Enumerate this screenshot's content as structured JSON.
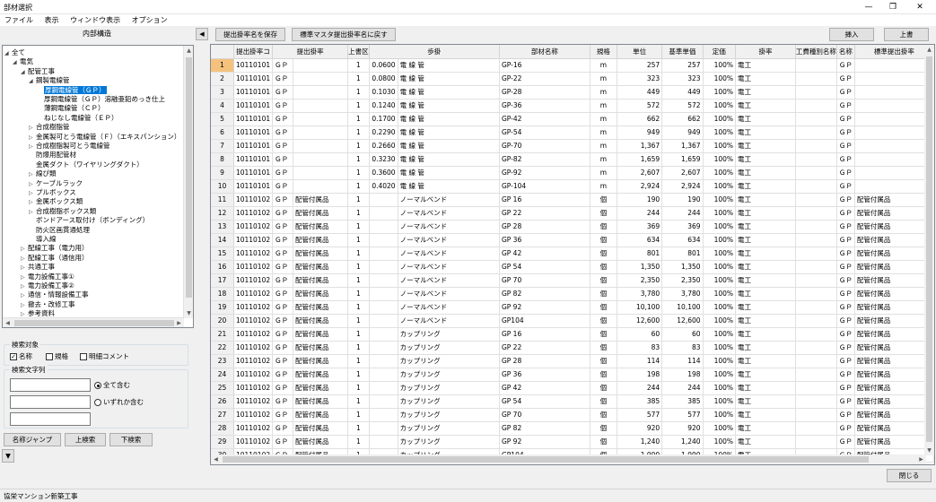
{
  "window": {
    "title": "部材選択",
    "minimize": "—",
    "restore": "❐",
    "close": "✕"
  },
  "menu": [
    "ファイル",
    "表示",
    "ウィンドウ表示",
    "オプション"
  ],
  "left_panel": {
    "title": "内部構造",
    "collapse_icon": "◀"
  },
  "tree": [
    {
      "label": "全て",
      "level": 0,
      "tw": "◢"
    },
    {
      "label": "電気",
      "level": 1,
      "tw": "◢"
    },
    {
      "label": "配管工事",
      "level": 2,
      "tw": "◢"
    },
    {
      "label": "鋼製電線管",
      "level": 3,
      "tw": "◢"
    },
    {
      "label": "厚鋼電線管（ＧＰ）",
      "level": 4,
      "tw": "",
      "selected": true
    },
    {
      "label": "厚鋼電線管（ＧＰ）溶融亜鉛めっき仕上",
      "level": 4,
      "tw": ""
    },
    {
      "label": "薄鋼電線管（ＣＰ）",
      "level": 4,
      "tw": ""
    },
    {
      "label": "ねじなし電線管（ＥＰ）",
      "level": 4,
      "tw": ""
    },
    {
      "label": "合成樹脂管",
      "level": 3,
      "tw": "▷"
    },
    {
      "label": "金属製可とう電線管（Ｆ）（エキスパンション）",
      "level": 3,
      "tw": "▷"
    },
    {
      "label": "合成樹脂製可とう電線管",
      "level": 3,
      "tw": "▷"
    },
    {
      "label": "防爆用配管材",
      "level": 3,
      "tw": ""
    },
    {
      "label": "金属ダクト（ワイヤリングダクト）",
      "level": 3,
      "tw": ""
    },
    {
      "label": "線ぴ類",
      "level": 3,
      "tw": "▷"
    },
    {
      "label": "ケーブルラック",
      "level": 3,
      "tw": "▷"
    },
    {
      "label": "プルボックス",
      "level": 3,
      "tw": "▷"
    },
    {
      "label": "金属ボックス類",
      "level": 3,
      "tw": "▷"
    },
    {
      "label": "合成樹脂ボックス類",
      "level": 3,
      "tw": "▷"
    },
    {
      "label": "ボンドアース取付け（ボンディング）",
      "level": 3,
      "tw": ""
    },
    {
      "label": "防火区画貫通処理",
      "level": 3,
      "tw": ""
    },
    {
      "label": "導入線",
      "level": 3,
      "tw": ""
    },
    {
      "label": "配線工事（電力用）",
      "level": 2,
      "tw": "▷"
    },
    {
      "label": "配線工事（通信用）",
      "level": 2,
      "tw": "▷"
    },
    {
      "label": "共通工事",
      "level": 2,
      "tw": "▷"
    },
    {
      "label": "電力設備工事①",
      "level": 2,
      "tw": "▷"
    },
    {
      "label": "電力設備工事②",
      "level": 2,
      "tw": "▷"
    },
    {
      "label": "通信・情報設備工事",
      "level": 2,
      "tw": "▷"
    },
    {
      "label": "撤去・改修工事",
      "level": 2,
      "tw": "▷"
    },
    {
      "label": "参考資料",
      "level": 2,
      "tw": "▷"
    }
  ],
  "search_target": {
    "title": "検索対象",
    "name": "名称",
    "spec": "規格",
    "comment": "明細コメント",
    "name_checked": "✓"
  },
  "search_text": {
    "title": "検索文字列",
    "all": "全て含む",
    "any": "いずれか含む"
  },
  "buttons": {
    "name_jump": "名称ジャンプ",
    "up_search": "上検索",
    "down_search": "下検索",
    "expand": "▼",
    "save_rate": "提出掛率名を保存",
    "reset_rate": "標準マスタ提出掛率名に戻す",
    "insert": "挿入",
    "overwrite": "上書",
    "close": "閉じる"
  },
  "grid": {
    "headers": [
      "",
      "提出掛率コ",
      "提出掛率",
      "上書区",
      "歩掛",
      "部材名称",
      "規格",
      "単位",
      "基準単価",
      "定価",
      "掛率",
      "工費種別名称",
      "名称",
      "標準提出掛率"
    ],
    "rows": [
      [
        "1",
        "10110101",
        "ＧＰ",
        "",
        "1",
        "0.0600",
        "電 線 管",
        "GP-16",
        "m",
        "257",
        "257",
        "100%",
        "電工",
        "",
        "ＧＰ",
        ""
      ],
      [
        "2",
        "10110101",
        "ＧＰ",
        "",
        "1",
        "0.0800",
        "電 線 管",
        "GP-22",
        "m",
        "323",
        "323",
        "100%",
        "電工",
        "",
        "ＧＰ",
        ""
      ],
      [
        "3",
        "10110101",
        "ＧＰ",
        "",
        "1",
        "0.1030",
        "電 線 管",
        "GP-28",
        "m",
        "449",
        "449",
        "100%",
        "電工",
        "",
        "ＧＰ",
        ""
      ],
      [
        "4",
        "10110101",
        "ＧＰ",
        "",
        "1",
        "0.1240",
        "電 線 管",
        "GP-36",
        "m",
        "572",
        "572",
        "100%",
        "電工",
        "",
        "ＧＰ",
        ""
      ],
      [
        "5",
        "10110101",
        "ＧＰ",
        "",
        "1",
        "0.1700",
        "電 線 管",
        "GP-42",
        "m",
        "662",
        "662",
        "100%",
        "電工",
        "",
        "ＧＰ",
        ""
      ],
      [
        "6",
        "10110101",
        "ＧＰ",
        "",
        "1",
        "0.2290",
        "電 線 管",
        "GP-54",
        "m",
        "949",
        "949",
        "100%",
        "電工",
        "",
        "ＧＰ",
        ""
      ],
      [
        "7",
        "10110101",
        "ＧＰ",
        "",
        "1",
        "0.2660",
        "電 線 管",
        "GP-70",
        "m",
        "1,367",
        "1,367",
        "100%",
        "電工",
        "",
        "ＧＰ",
        ""
      ],
      [
        "8",
        "10110101",
        "ＧＰ",
        "",
        "1",
        "0.3230",
        "電 線 管",
        "GP-82",
        "m",
        "1,659",
        "1,659",
        "100%",
        "電工",
        "",
        "ＧＰ",
        ""
      ],
      [
        "9",
        "10110101",
        "ＧＰ",
        "",
        "1",
        "0.3600",
        "電 線 管",
        "GP-92",
        "m",
        "2,607",
        "2,607",
        "100%",
        "電工",
        "",
        "ＧＰ",
        ""
      ],
      [
        "10",
        "10110101",
        "ＧＰ",
        "",
        "1",
        "0.4020",
        "電 線 管",
        "GP-104",
        "m",
        "2,924",
        "2,924",
        "100%",
        "電工",
        "",
        "ＧＰ",
        ""
      ],
      [
        "11",
        "10110102",
        "ＧＰ",
        "配管付属品",
        "1",
        "",
        "ノーマルベンド",
        "GP 16",
        "個",
        "190",
        "190",
        "100%",
        "電工",
        "",
        "ＧＰ",
        "配管付属品"
      ],
      [
        "12",
        "10110102",
        "ＧＰ",
        "配管付属品",
        "1",
        "",
        "ノーマルベンド",
        "GP 22",
        "個",
        "244",
        "244",
        "100%",
        "電工",
        "",
        "ＧＰ",
        "配管付属品"
      ],
      [
        "13",
        "10110102",
        "ＧＰ",
        "配管付属品",
        "1",
        "",
        "ノーマルベンド",
        "GP 28",
        "個",
        "369",
        "369",
        "100%",
        "電工",
        "",
        "ＧＰ",
        "配管付属品"
      ],
      [
        "14",
        "10110102",
        "ＧＰ",
        "配管付属品",
        "1",
        "",
        "ノーマルベンド",
        "GP 36",
        "個",
        "634",
        "634",
        "100%",
        "電工",
        "",
        "ＧＰ",
        "配管付属品"
      ],
      [
        "15",
        "10110102",
        "ＧＰ",
        "配管付属品",
        "1",
        "",
        "ノーマルベンド",
        "GP 42",
        "個",
        "801",
        "801",
        "100%",
        "電工",
        "",
        "ＧＰ",
        "配管付属品"
      ],
      [
        "16",
        "10110102",
        "ＧＰ",
        "配管付属品",
        "1",
        "",
        "ノーマルベンド",
        "GP 54",
        "個",
        "1,350",
        "1,350",
        "100%",
        "電工",
        "",
        "ＧＰ",
        "配管付属品"
      ],
      [
        "17",
        "10110102",
        "ＧＰ",
        "配管付属品",
        "1",
        "",
        "ノーマルベンド",
        "GP 70",
        "個",
        "2,350",
        "2,350",
        "100%",
        "電工",
        "",
        "ＧＰ",
        "配管付属品"
      ],
      [
        "18",
        "10110102",
        "ＧＰ",
        "配管付属品",
        "1",
        "",
        "ノーマルベンド",
        "GP 82",
        "個",
        "3,780",
        "3,780",
        "100%",
        "電工",
        "",
        "ＧＰ",
        "配管付属品"
      ],
      [
        "19",
        "10110102",
        "ＧＰ",
        "配管付属品",
        "1",
        "",
        "ノーマルベンド",
        "GP 92",
        "個",
        "10,100",
        "10,100",
        "100%",
        "電工",
        "",
        "ＧＰ",
        "配管付属品"
      ],
      [
        "20",
        "10110102",
        "ＧＰ",
        "配管付属品",
        "1",
        "",
        "ノーマルベンド",
        "GP104",
        "個",
        "12,600",
        "12,600",
        "100%",
        "電工",
        "",
        "ＧＰ",
        "配管付属品"
      ],
      [
        "21",
        "10110102",
        "ＧＰ",
        "配管付属品",
        "1",
        "",
        "カップリング",
        "GP 16",
        "個",
        "60",
        "60",
        "100%",
        "電工",
        "",
        "ＧＰ",
        "配管付属品"
      ],
      [
        "22",
        "10110102",
        "ＧＰ",
        "配管付属品",
        "1",
        "",
        "カップリング",
        "GP 22",
        "個",
        "83",
        "83",
        "100%",
        "電工",
        "",
        "ＧＰ",
        "配管付属品"
      ],
      [
        "23",
        "10110102",
        "ＧＰ",
        "配管付属品",
        "1",
        "",
        "カップリング",
        "GP 28",
        "個",
        "114",
        "114",
        "100%",
        "電工",
        "",
        "ＧＰ",
        "配管付属品"
      ],
      [
        "24",
        "10110102",
        "ＧＰ",
        "配管付属品",
        "1",
        "",
        "カップリング",
        "GP 36",
        "個",
        "198",
        "198",
        "100%",
        "電工",
        "",
        "ＧＰ",
        "配管付属品"
      ],
      [
        "25",
        "10110102",
        "ＧＰ",
        "配管付属品",
        "1",
        "",
        "カップリング",
        "GP 42",
        "個",
        "244",
        "244",
        "100%",
        "電工",
        "",
        "ＧＰ",
        "配管付属品"
      ],
      [
        "26",
        "10110102",
        "ＧＰ",
        "配管付属品",
        "1",
        "",
        "カップリング",
        "GP 54",
        "個",
        "385",
        "385",
        "100%",
        "電工",
        "",
        "ＧＰ",
        "配管付属品"
      ],
      [
        "27",
        "10110102",
        "ＧＰ",
        "配管付属品",
        "1",
        "",
        "カップリング",
        "GP 70",
        "個",
        "577",
        "577",
        "100%",
        "電工",
        "",
        "ＧＰ",
        "配管付属品"
      ],
      [
        "28",
        "10110102",
        "ＧＰ",
        "配管付属品",
        "1",
        "",
        "カップリング",
        "GP 82",
        "個",
        "920",
        "920",
        "100%",
        "電工",
        "",
        "ＧＰ",
        "配管付属品"
      ],
      [
        "29",
        "10110102",
        "ＧＰ",
        "配管付属品",
        "1",
        "",
        "カップリング",
        "GP 92",
        "個",
        "1,240",
        "1,240",
        "100%",
        "電工",
        "",
        "ＧＰ",
        "配管付属品"
      ],
      [
        "30",
        "10110102",
        "ＧＰ",
        "配管付属品",
        "1",
        "",
        "カップリング",
        "GP104",
        "個",
        "1,990",
        "1,990",
        "100%",
        "電工",
        "",
        "ＧＰ",
        "配管付属品"
      ]
    ]
  },
  "status": {
    "project": "協栄マンション新築工事"
  },
  "colors": {
    "selection": "#0078d7",
    "current_row": "#f5c27d"
  }
}
